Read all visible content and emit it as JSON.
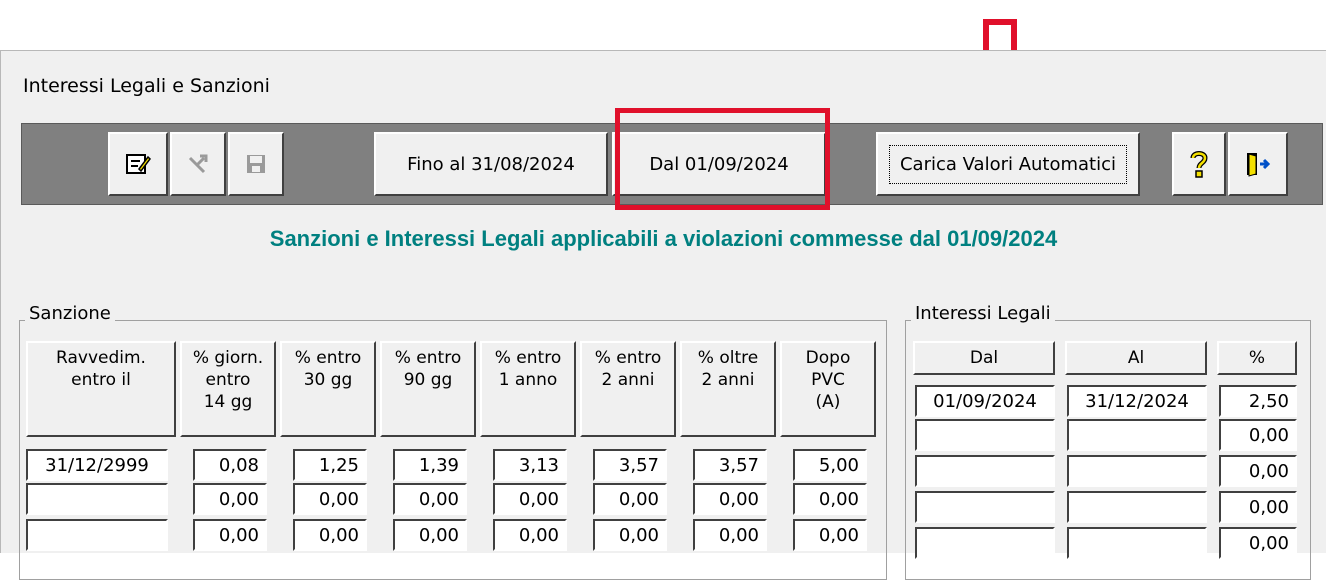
{
  "window": {
    "title": "Interessi Legali e Sanzioni"
  },
  "toolbar": {
    "edit_icon": "edit-icon",
    "cancel_icon": "cancel-icon",
    "save_icon": "save-icon",
    "fino_label": "Fino al 31/08/2024",
    "dal_label": "Dal 01/09/2024",
    "carica_label": "Carica Valori Automatici",
    "help_icon": "question-icon",
    "exit_icon": "exit-door-icon"
  },
  "header": {
    "text": "Sanzioni e Interessi Legali applicabili a violazioni commesse dal 01/09/2024"
  },
  "sanzione": {
    "label": "Sanzione",
    "columns": [
      {
        "line1": "Ravvedim.",
        "line2": "entro il",
        "line3": ""
      },
      {
        "line1": "% giorn.",
        "line2": "entro",
        "line3": "14 gg"
      },
      {
        "line1": "% entro",
        "line2": "30 gg",
        "line3": ""
      },
      {
        "line1": "% entro",
        "line2": "90 gg",
        "line3": ""
      },
      {
        "line1": "% entro",
        "line2": "1 anno",
        "line3": ""
      },
      {
        "line1": "% entro",
        "line2": "2 anni",
        "line3": ""
      },
      {
        "line1": "% oltre",
        "line2": "2 anni",
        "line3": ""
      },
      {
        "line1": "Dopo",
        "line2": "PVC",
        "line3": "(A)"
      }
    ],
    "rows": [
      [
        "31/12/2999",
        "0,08",
        "1,25",
        "1,39",
        "3,13",
        "3,57",
        "3,57",
        "5,00"
      ],
      [
        "",
        "0,00",
        "0,00",
        "0,00",
        "0,00",
        "0,00",
        "0,00",
        "0,00"
      ],
      [
        "",
        "0,00",
        "0,00",
        "0,00",
        "0,00",
        "0,00",
        "0,00",
        "0,00"
      ]
    ]
  },
  "interessi": {
    "label": "Interessi Legali",
    "columns": [
      "Dal",
      "Al",
      "%"
    ],
    "rows": [
      [
        "01/09/2024",
        "31/12/2024",
        "2,50"
      ],
      [
        "",
        "",
        "0,00"
      ],
      [
        "",
        "",
        "0,00"
      ],
      [
        "",
        "",
        "0,00"
      ],
      [
        "",
        "",
        "0,00"
      ]
    ]
  },
  "colors": {
    "annotation": "#e0102b",
    "header": "#008080",
    "toolbar": "#808080"
  }
}
